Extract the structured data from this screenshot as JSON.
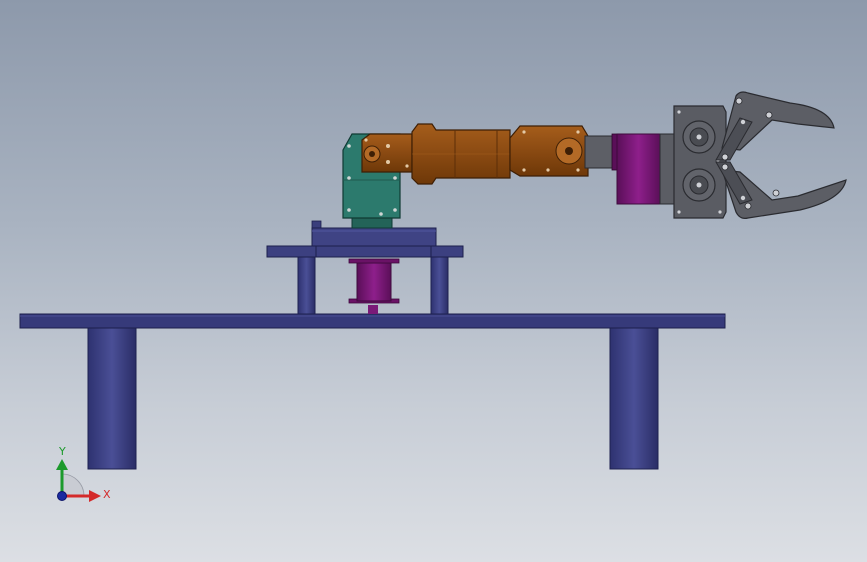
{
  "viewport": {
    "background_top": "#8d99ab",
    "background_bottom": "#dcdfe4"
  },
  "model": {
    "parts": [
      "table-top",
      "table-leg-left",
      "table-leg-right",
      "base-plate",
      "base-post-left",
      "base-post-right",
      "base-motor",
      "turntable",
      "shoulder-joint",
      "upper-arm",
      "elbow-joint",
      "wrist-motor",
      "gripper-body",
      "gripper-jaw-upper",
      "gripper-jaw-lower"
    ],
    "colors": {
      "structure_blue": "#3a3e7c",
      "structure_blue_dark": "#252856",
      "joint_teal": "#2c7a6d",
      "arm_copper": "#8a4a12",
      "arm_copper_light": "#a8621f",
      "motor_purple": "#7a1a78",
      "gripper_gray": "#5a5c63",
      "gripper_gray_dark": "#3c3e44"
    }
  },
  "triad": {
    "x_label": "X",
    "y_label": "Y",
    "x_color": "#d42a2a",
    "y_color": "#1c9a2c",
    "z_color": "#1a2aa0"
  }
}
